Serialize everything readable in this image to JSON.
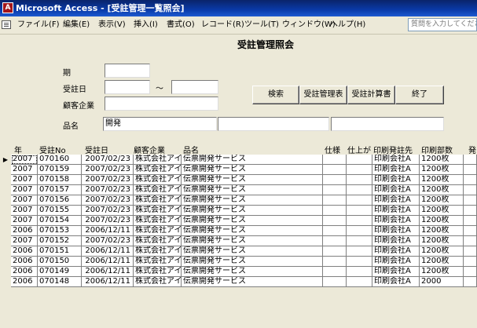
{
  "window": {
    "title": "Microsoft Access - [受註管理一覧照会]",
    "icon_label": "A"
  },
  "menubar": {
    "items": [
      "ファイル(F)",
      "編集(E)",
      "表示(V)",
      "挿入(I)",
      "書式(O)",
      "レコード(R)",
      "ツール(T)",
      "ウィンドウ(W)",
      "ヘルプ(H)"
    ],
    "question_placeholder": "質問を入力してください"
  },
  "form": {
    "title": "受註管理照会",
    "labels": {
      "period": "期",
      "order_date": "受註日",
      "tilde": "～",
      "customer": "顧客企業",
      "product": "品名"
    },
    "fields": {
      "period": "",
      "order_date_from": "",
      "order_date_to": "",
      "customer": "",
      "product": "開発",
      "product_2": "",
      "product_3": ""
    },
    "buttons": {
      "search": "検索",
      "order_table": "受註管理表",
      "calc_sheet": "受註計算書",
      "exit": "終了"
    }
  },
  "grid": {
    "headers": [
      "年",
      "受註No",
      "受註日",
      "顧客企業",
      "品名",
      "仕様",
      "仕上がり",
      "印刷発註先",
      "印刷部数",
      "発"
    ],
    "current_row_marker": "▶",
    "rows": [
      [
        "2007",
        "070160",
        "2007/02/23",
        "株式会社アイ",
        "伝票開発サービス",
        "",
        "",
        "印刷会社A",
        "1200枚"
      ],
      [
        "2007",
        "070159",
        "2007/02/23",
        "株式会社アイ",
        "伝票開発サービス",
        "",
        "",
        "印刷会社A",
        "1200枚"
      ],
      [
        "2007",
        "070158",
        "2007/02/23",
        "株式会社アイ",
        "伝票開発サービス",
        "",
        "",
        "印刷会社A",
        "1200枚"
      ],
      [
        "2007",
        "070157",
        "2007/02/23",
        "株式会社アイ",
        "伝票開発サービス",
        "",
        "",
        "印刷会社A",
        "1200枚"
      ],
      [
        "2007",
        "070156",
        "2007/02/23",
        "株式会社アイ",
        "伝票開発サービス",
        "",
        "",
        "印刷会社A",
        "1200枚"
      ],
      [
        "2007",
        "070155",
        "2007/02/23",
        "株式会社アイ",
        "伝票開発サービス",
        "",
        "",
        "印刷会社A",
        "1200枚"
      ],
      [
        "2007",
        "070154",
        "2007/02/23",
        "株式会社アイ",
        "伝票開発サービス",
        "",
        "",
        "印刷会社A",
        "1200枚"
      ],
      [
        "2006",
        "070153",
        "2006/12/11",
        "株式会社アイ",
        "伝票開発サービス",
        "",
        "",
        "印刷会社A",
        "1200枚"
      ],
      [
        "2007",
        "070152",
        "2007/02/23",
        "株式会社アイ",
        "伝票開発サービス",
        "",
        "",
        "印刷会社A",
        "1200枚"
      ],
      [
        "2006",
        "070151",
        "2006/12/11",
        "株式会社アイ",
        "伝票開発サービス",
        "",
        "",
        "印刷会社A",
        "1200枚"
      ],
      [
        "2006",
        "070150",
        "2006/12/11",
        "株式会社アイ",
        "伝票開発サービス",
        "",
        "",
        "印刷会社A",
        "1200枚"
      ],
      [
        "2006",
        "070149",
        "2006/12/11",
        "株式会社アイ",
        "伝票開発サービス",
        "",
        "",
        "印刷会社A",
        "1200枚"
      ],
      [
        "2006",
        "070148",
        "2006/12/11",
        "株式会社アイ",
        "伝票開発サービス",
        "",
        "",
        "印刷会社A",
        "2000"
      ]
    ]
  }
}
